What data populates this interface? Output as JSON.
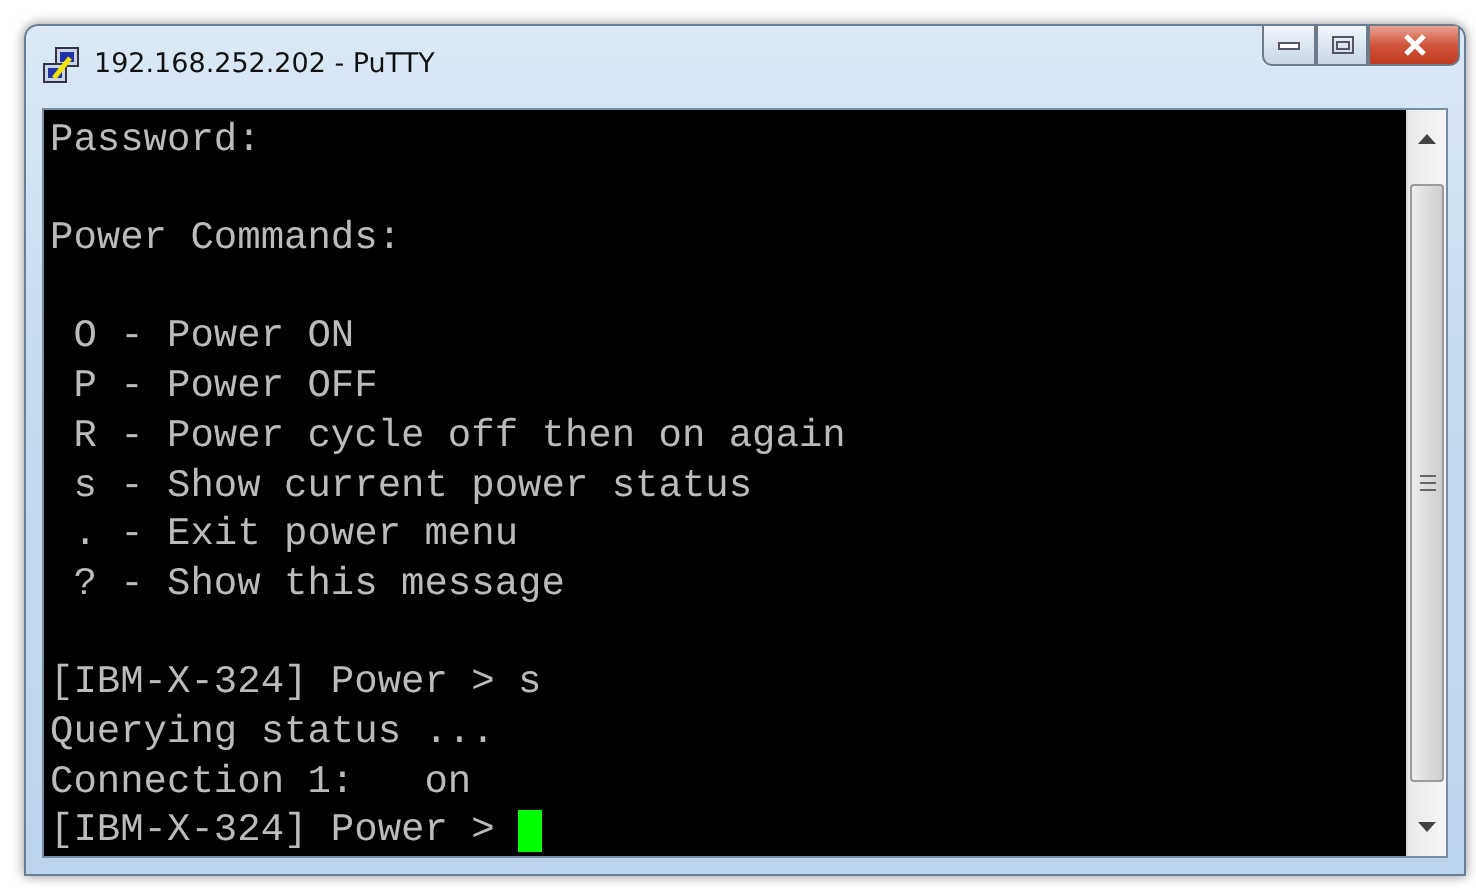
{
  "window": {
    "title": "192.168.252.202 - PuTTY"
  },
  "terminal": {
    "blocks": [
      [
        "Password:"
      ],
      [
        "Power Commands:"
      ],
      [
        " O - Power ON",
        " P - Power OFF",
        " R - Power cycle off then on again",
        " s - Show current power status",
        " . - Exit power menu",
        " ? - Show this message"
      ],
      [
        "[IBM-X-324] Power > s",
        "Querying status ...",
        "Connection 1:   on",
        "[IBM-X-324] Power > "
      ]
    ],
    "cursor": true
  }
}
